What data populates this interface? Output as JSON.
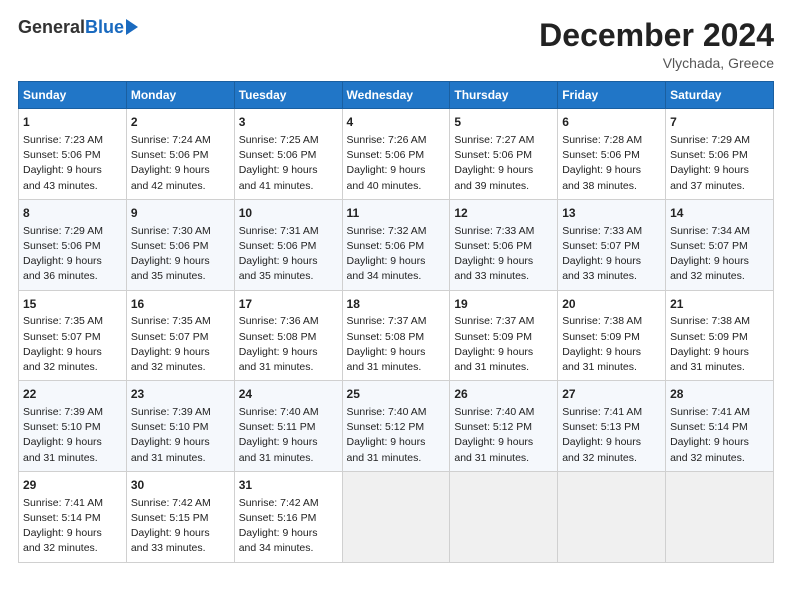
{
  "header": {
    "logo_general": "General",
    "logo_blue": "Blue",
    "main_title": "December 2024",
    "subtitle": "Vlychada, Greece"
  },
  "calendar": {
    "weekdays": [
      "Sunday",
      "Monday",
      "Tuesday",
      "Wednesday",
      "Thursday",
      "Friday",
      "Saturday"
    ],
    "weeks": [
      [
        {
          "day": "1",
          "info": "Sunrise: 7:23 AM\nSunset: 5:06 PM\nDaylight: 9 hours and 43 minutes."
        },
        {
          "day": "2",
          "info": "Sunrise: 7:24 AM\nSunset: 5:06 PM\nDaylight: 9 hours and 42 minutes."
        },
        {
          "day": "3",
          "info": "Sunrise: 7:25 AM\nSunset: 5:06 PM\nDaylight: 9 hours and 41 minutes."
        },
        {
          "day": "4",
          "info": "Sunrise: 7:26 AM\nSunset: 5:06 PM\nDaylight: 9 hours and 40 minutes."
        },
        {
          "day": "5",
          "info": "Sunrise: 7:27 AM\nSunset: 5:06 PM\nDaylight: 9 hours and 39 minutes."
        },
        {
          "day": "6",
          "info": "Sunrise: 7:28 AM\nSunset: 5:06 PM\nDaylight: 9 hours and 38 minutes."
        },
        {
          "day": "7",
          "info": "Sunrise: 7:29 AM\nSunset: 5:06 PM\nDaylight: 9 hours and 37 minutes."
        }
      ],
      [
        {
          "day": "8",
          "info": "Sunrise: 7:29 AM\nSunset: 5:06 PM\nDaylight: 9 hours and 36 minutes."
        },
        {
          "day": "9",
          "info": "Sunrise: 7:30 AM\nSunset: 5:06 PM\nDaylight: 9 hours and 35 minutes."
        },
        {
          "day": "10",
          "info": "Sunrise: 7:31 AM\nSunset: 5:06 PM\nDaylight: 9 hours and 35 minutes."
        },
        {
          "day": "11",
          "info": "Sunrise: 7:32 AM\nSunset: 5:06 PM\nDaylight: 9 hours and 34 minutes."
        },
        {
          "day": "12",
          "info": "Sunrise: 7:33 AM\nSunset: 5:06 PM\nDaylight: 9 hours and 33 minutes."
        },
        {
          "day": "13",
          "info": "Sunrise: 7:33 AM\nSunset: 5:07 PM\nDaylight: 9 hours and 33 minutes."
        },
        {
          "day": "14",
          "info": "Sunrise: 7:34 AM\nSunset: 5:07 PM\nDaylight: 9 hours and 32 minutes."
        }
      ],
      [
        {
          "day": "15",
          "info": "Sunrise: 7:35 AM\nSunset: 5:07 PM\nDaylight: 9 hours and 32 minutes."
        },
        {
          "day": "16",
          "info": "Sunrise: 7:35 AM\nSunset: 5:07 PM\nDaylight: 9 hours and 32 minutes."
        },
        {
          "day": "17",
          "info": "Sunrise: 7:36 AM\nSunset: 5:08 PM\nDaylight: 9 hours and 31 minutes."
        },
        {
          "day": "18",
          "info": "Sunrise: 7:37 AM\nSunset: 5:08 PM\nDaylight: 9 hours and 31 minutes."
        },
        {
          "day": "19",
          "info": "Sunrise: 7:37 AM\nSunset: 5:09 PM\nDaylight: 9 hours and 31 minutes."
        },
        {
          "day": "20",
          "info": "Sunrise: 7:38 AM\nSunset: 5:09 PM\nDaylight: 9 hours and 31 minutes."
        },
        {
          "day": "21",
          "info": "Sunrise: 7:38 AM\nSunset: 5:09 PM\nDaylight: 9 hours and 31 minutes."
        }
      ],
      [
        {
          "day": "22",
          "info": "Sunrise: 7:39 AM\nSunset: 5:10 PM\nDaylight: 9 hours and 31 minutes."
        },
        {
          "day": "23",
          "info": "Sunrise: 7:39 AM\nSunset: 5:10 PM\nDaylight: 9 hours and 31 minutes."
        },
        {
          "day": "24",
          "info": "Sunrise: 7:40 AM\nSunset: 5:11 PM\nDaylight: 9 hours and 31 minutes."
        },
        {
          "day": "25",
          "info": "Sunrise: 7:40 AM\nSunset: 5:12 PM\nDaylight: 9 hours and 31 minutes."
        },
        {
          "day": "26",
          "info": "Sunrise: 7:40 AM\nSunset: 5:12 PM\nDaylight: 9 hours and 31 minutes."
        },
        {
          "day": "27",
          "info": "Sunrise: 7:41 AM\nSunset: 5:13 PM\nDaylight: 9 hours and 32 minutes."
        },
        {
          "day": "28",
          "info": "Sunrise: 7:41 AM\nSunset: 5:14 PM\nDaylight: 9 hours and 32 minutes."
        }
      ],
      [
        {
          "day": "29",
          "info": "Sunrise: 7:41 AM\nSunset: 5:14 PM\nDaylight: 9 hours and 32 minutes."
        },
        {
          "day": "30",
          "info": "Sunrise: 7:42 AM\nSunset: 5:15 PM\nDaylight: 9 hours and 33 minutes."
        },
        {
          "day": "31",
          "info": "Sunrise: 7:42 AM\nSunset: 5:16 PM\nDaylight: 9 hours and 34 minutes."
        },
        null,
        null,
        null,
        null
      ]
    ]
  }
}
